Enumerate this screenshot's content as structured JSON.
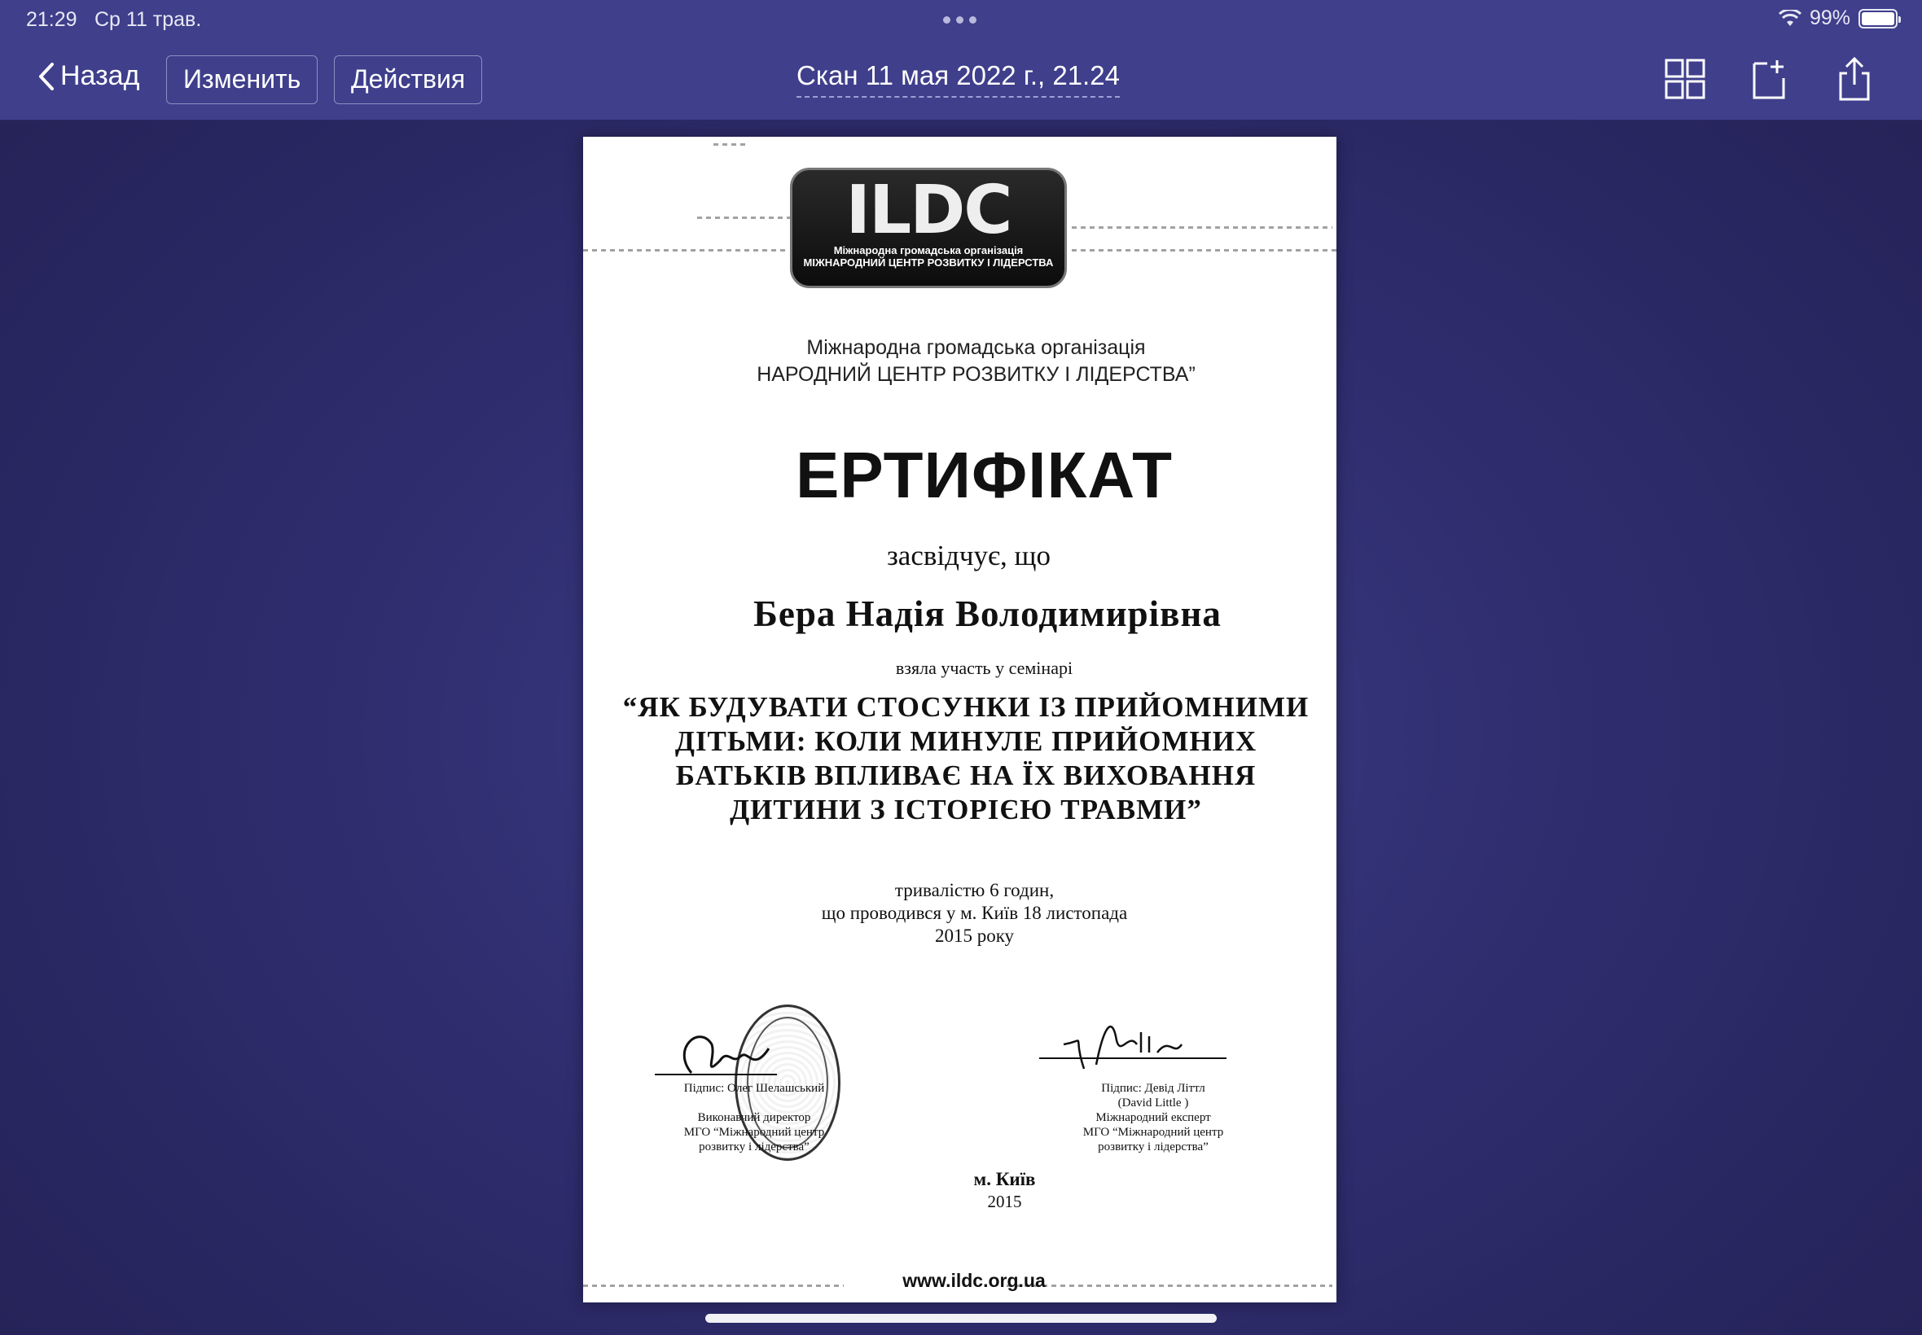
{
  "status_bar": {
    "time": "21:29",
    "date": "Ср 11 трав.",
    "battery": "99%",
    "battery_level": 0.99
  },
  "nav": {
    "back_label": "Назад",
    "edit_label": "Изменить",
    "actions_label": "Действия",
    "title": "Скан 11 мая 2022 г., 21.24",
    "icons": [
      "grid-icon",
      "add-page-icon",
      "share-icon"
    ]
  },
  "document": {
    "logo": {
      "mark": "ILDC",
      "line1": "Міжнародна громадська організація",
      "line2": "МІЖНАРОДНИЙ ЦЕНТР РОЗВИТКУ І ЛІДЕРСТВА"
    },
    "org_line1": "Міжнародна громадська організація",
    "org_line2": "НАРОДНИЙ ЦЕНТР РОЗВИТКУ І ЛІДЕРСТВА”",
    "title": "ЕРТИФІКАТ",
    "certifies": "засвідчує, що",
    "person": "Бера Надія Володимирівна",
    "took_part": "взяла участь у семінарі",
    "seminar": "“ЯК БУДУВАТИ СТОСУНКИ ІЗ ПРИЙОМНИМИ ДІТЬМИ: КОЛИ МИНУЛЕ ПРИЙОМНИХ БАТЬКІВ ВПЛИВАЄ НА ЇХ ВИХОВАННЯ ДИТИНИ З ІСТОРІЄЮ ТРАВМИ”",
    "details_line1": "тривалістю 6 годин,",
    "details_line2": "що проводився у м. Київ 18 листопада",
    "details_line3": "2015 року",
    "sig_left": {
      "name": "Підпис: Олег Шелашський",
      "role1": "Виконавчий директор",
      "role2": "МГО “Міжнародний центр",
      "role3": "розвитку і лідерства”"
    },
    "sig_right": {
      "name": "Підпис: Девід Літтл",
      "name_en": "(David Little )",
      "role1": "Міжнародний експерт",
      "role2": "МГО “Міжнародний центр",
      "role3": "розвитку і лідерства”"
    },
    "city": "м. Київ",
    "year": "2015",
    "website": "www.ildc.org.ua"
  }
}
